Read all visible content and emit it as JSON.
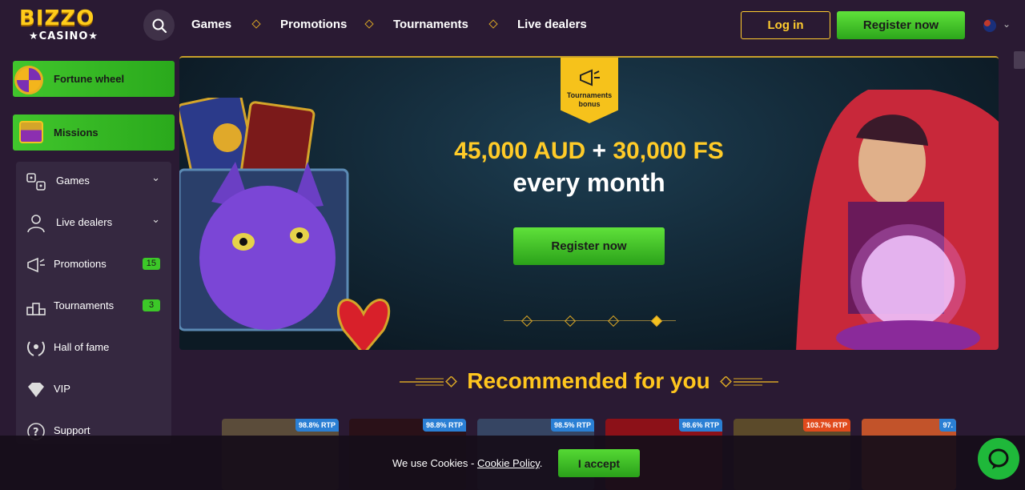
{
  "header": {
    "logo_top": "BIZZO",
    "logo_bottom": "★CASINO★",
    "nav": [
      "Games",
      "Promotions",
      "Tournaments",
      "Live dealers"
    ],
    "login_label": "Log in",
    "register_label": "Register now",
    "language_icon": "australia-flag-icon"
  },
  "sidebar": {
    "promo_cards": [
      {
        "label": "Fortune wheel",
        "icon": "fortune-wheel-icon"
      },
      {
        "label": "Missions",
        "icon": "treasure-chest-icon"
      }
    ],
    "items": [
      {
        "label": "Games",
        "icon": "games-icon",
        "expandable": true
      },
      {
        "label": "Live dealers",
        "icon": "dealer-icon",
        "expandable": true
      },
      {
        "label": "Promotions",
        "icon": "megaphone-icon",
        "badge": "15"
      },
      {
        "label": "Tournaments",
        "icon": "podium-icon",
        "badge": "3"
      },
      {
        "label": "Hall of fame",
        "icon": "laurel-icon"
      },
      {
        "label": "VIP",
        "icon": "diamond-icon"
      },
      {
        "label": "Support",
        "icon": "question-icon"
      }
    ]
  },
  "banner": {
    "badge_text": "Tournaments bonus",
    "amount_aud": "45,000 AUD",
    "plus": "+",
    "amount_fs": "30,000 FS",
    "subtitle": "every month",
    "cta_label": "Register now",
    "slides_total": 4,
    "active_slide": 4
  },
  "recommended": {
    "title": "Recommended for you",
    "games": [
      {
        "rtp": "98.8% RTP",
        "hot": false,
        "color": "#6a5b4a"
      },
      {
        "rtp": "98.8% RTP",
        "hot": false,
        "color": "#3a1620"
      },
      {
        "rtp": "98.5% RTP",
        "hot": false,
        "color": "#3c4a66"
      },
      {
        "rtp": "98.6% RTP",
        "hot": false,
        "color": "#8c1118"
      },
      {
        "rtp": "103.7% RTP",
        "hot": true,
        "color": "#5b4a2a"
      },
      {
        "rtp": "97.",
        "hot": false,
        "color": "#c2532a"
      }
    ]
  },
  "cookie": {
    "text": "We use Cookies - ",
    "link": "Cookie Policy",
    "after": ".",
    "accept_label": "I accept"
  },
  "colors": {
    "background": "#2a1a33",
    "accent_gold": "#ffcb28",
    "accent_green": "#3cc828"
  }
}
